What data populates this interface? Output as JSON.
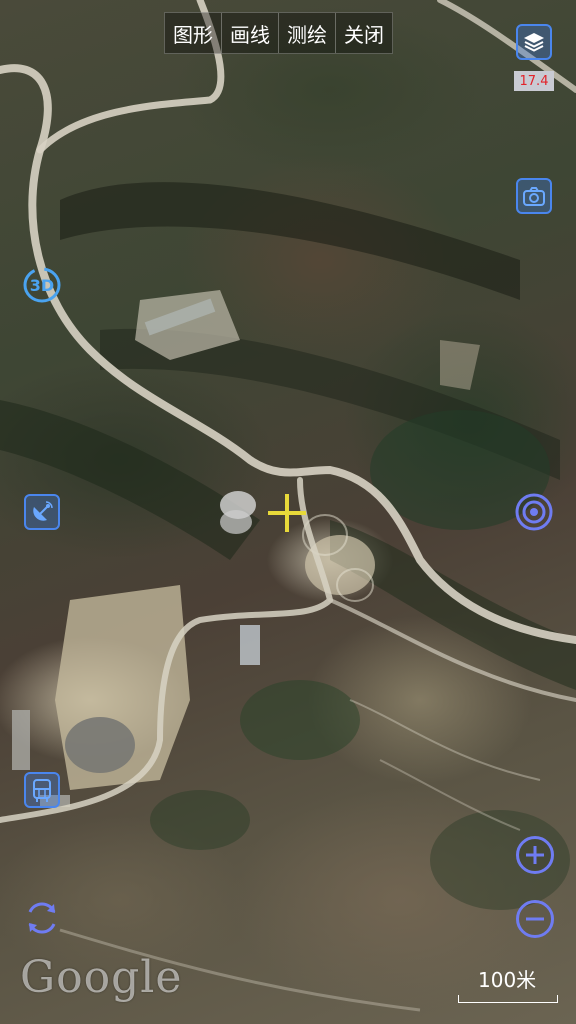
{
  "toolbar": {
    "shapes": "图形",
    "draw_line": "画线",
    "measure": "测绘",
    "close": "关闭"
  },
  "zoom_level": "17.4",
  "buttons": {
    "layers": "layers-icon",
    "camera": "camera-icon",
    "view_3d": "3D",
    "satellite": "satellite-dish-icon",
    "locate": "target-icon",
    "bus": "bus-icon",
    "zoom_in": "plus-icon",
    "zoom_out": "minus-icon",
    "rotate": "rotate-icon"
  },
  "attribution": "Google",
  "scale": {
    "label": "100米"
  },
  "colors": {
    "accent_blue": "#4a86ee",
    "ring_purple": "#6f7cf2",
    "crosshair": "#e8d93a",
    "zoom_text": "#e2232a"
  }
}
